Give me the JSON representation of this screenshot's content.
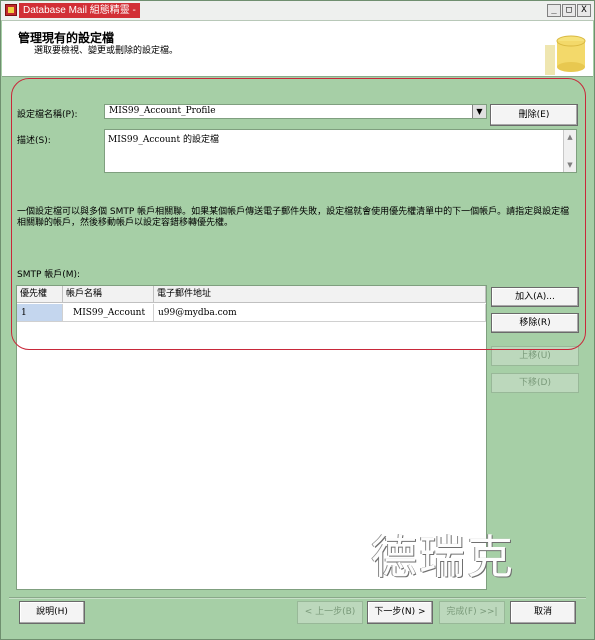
{
  "window": {
    "title": "Database Mail 組態精靈 -",
    "min_glyph": "_",
    "max_glyph": "□",
    "close_glyph": "X"
  },
  "header": {
    "title": "管理現有的設定檔",
    "subtitle": "選取要檢視、變更或刪除的設定檔。"
  },
  "profile": {
    "label": "設定檔名稱(P):",
    "value": "MIS99_Account_Profile",
    "delete_label": "刪除(E)",
    "desc_label": "描述(S):",
    "desc_value": "MIS99_Account 的設定檔"
  },
  "info": {
    "text": "一個設定檔可以與多個 SMTP 帳戶相關聯。如果某個帳戶傳送電子郵件失敗，設定檔就會使用優先權清單中的下一個帳戶。請指定與設定檔相關聯的帳戶，然後移動帳戶以設定容錯移轉優先權。"
  },
  "smtp": {
    "label": "SMTP 帳戶(M):",
    "columns": [
      "優先權",
      "帳戶名稱",
      "電子郵件地址"
    ],
    "rows": [
      [
        "1",
        "MIS99_Account",
        "u99@mydba.com"
      ]
    ],
    "add_label": "加入(A)...",
    "remove_label": "移除(R)",
    "up_label": "上移(U)",
    "down_label": "下移(D)"
  },
  "watermark": "德瑞克",
  "footer": {
    "help_label": "說明(H)",
    "back_label": "< 上一步(B)",
    "next_label": "下一步(N) >",
    "finish_label": "完成(F) >>|",
    "cancel_label": "取消"
  },
  "colors": {
    "background": "#a6cfa6",
    "highlight": "#c8283a",
    "title_bar": "#d22f36"
  }
}
